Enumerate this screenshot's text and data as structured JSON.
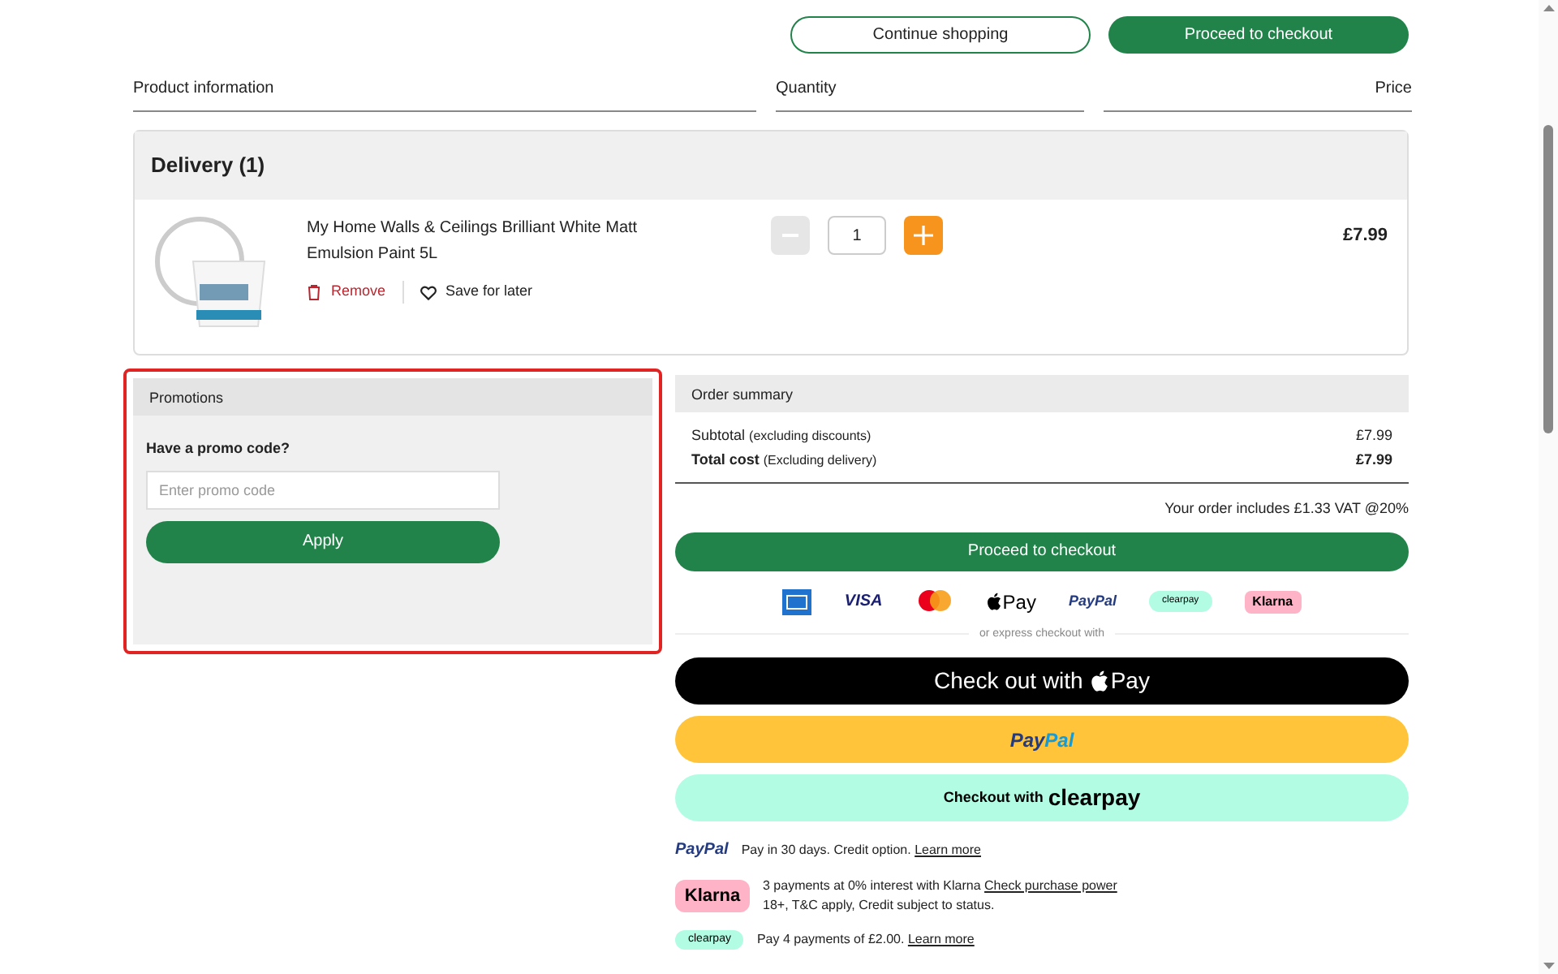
{
  "header_buttons": [
    {
      "label": "Continue shopping",
      "kind": "outline"
    },
    {
      "label": "Proceed to checkout",
      "kind": "primary"
    }
  ],
  "columns": [
    "Product information",
    "Quantity",
    "Price"
  ],
  "delivery": {
    "title": "Delivery (1)",
    "item": {
      "name": "My Home Walls & Ceilings Brilliant White Matt Emulsion Paint 5L",
      "remove": "Remove",
      "save": "Save for later",
      "quantity": "1",
      "price": "£7.99",
      "decrease_disabled": true
    }
  },
  "promotions": {
    "title": "Promotions",
    "label": "Have a promo code?",
    "placeholder": "Enter promo code",
    "button": "Apply",
    "highlighted": true
  },
  "order_summary": {
    "title": "Order summary",
    "rows": [
      {
        "label": "Subtotal",
        "note": "(excluding discounts)",
        "value": "£7.99",
        "bold": false
      },
      {
        "label": "Total cost",
        "note": "(Excluding delivery)",
        "value": "£7.99",
        "bold": true
      }
    ],
    "vat": "Your order includes £1.33 VAT @20%",
    "checkout": "Proceed to checkout",
    "payment_marks": [
      {
        "kind": "amex"
      },
      {
        "kind": "visa",
        "text": "VISA"
      },
      {
        "kind": "mastercard"
      },
      {
        "kind": "applepay",
        "text": "Pay"
      },
      {
        "kind": "paypal",
        "text": "PayPal"
      },
      {
        "kind": "clearpay",
        "text": "clearpay"
      },
      {
        "kind": "klarna",
        "text": "Klarna"
      }
    ]
  },
  "express_label": "or express checkout with",
  "express_buttons": [
    {
      "kind": "applepay",
      "label": "Check out with",
      "brand": "Pay"
    },
    {
      "kind": "paypal",
      "brand_parts": [
        "Pay",
        "Pal"
      ]
    },
    {
      "kind": "clearpay",
      "label": "Checkout with",
      "brand": "clearpay"
    }
  ],
  "offers": [
    {
      "kind": "paypal",
      "badge": "PayPal",
      "text": "Pay in 30 days. Credit option.",
      "link": "Learn more"
    },
    {
      "kind": "klarna",
      "badge": "Klarna",
      "text": "3 payments at 0% interest with Klarna",
      "link": "Check purchase power",
      "subtext": "18+, T&C apply, Credit subject to status."
    },
    {
      "kind": "clearpay",
      "badge": "clearpay",
      "text": "Pay 4 payments of £2.00.",
      "link": "Learn more"
    }
  ]
}
